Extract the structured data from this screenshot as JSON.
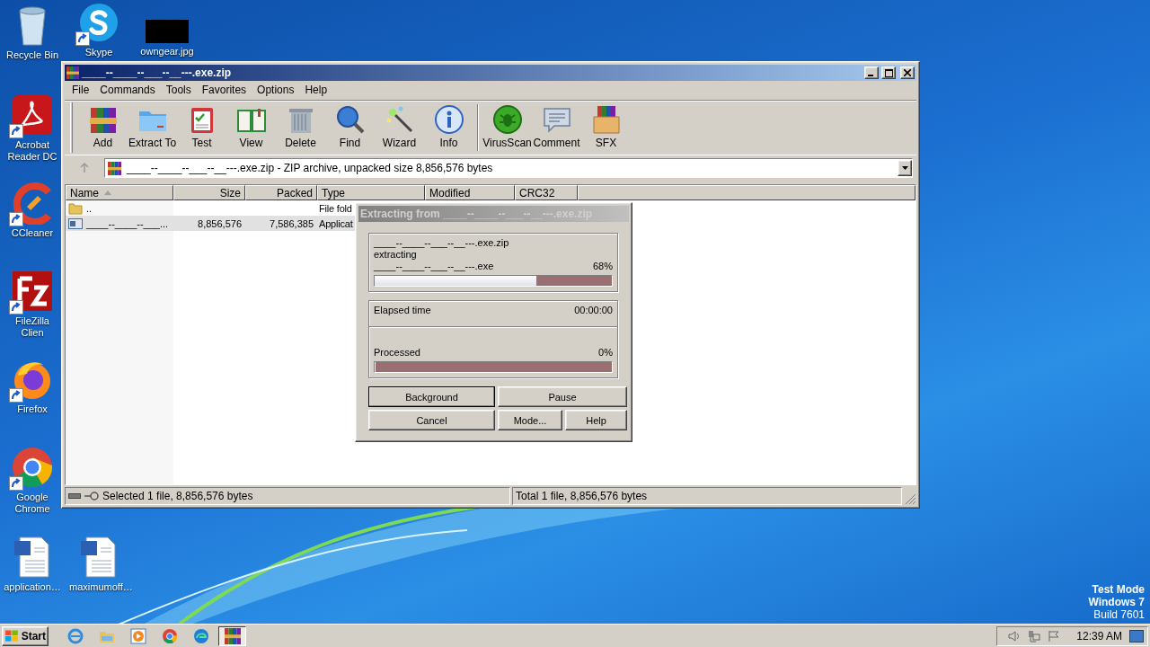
{
  "desktop_icons": [
    {
      "label": "Recycle Bin",
      "kind": "recycle",
      "shortcut": false
    },
    {
      "label": "Skype",
      "kind": "skype",
      "shortcut": true
    },
    {
      "label": "owngear.jpg",
      "kind": "redacted",
      "shortcut": false
    },
    {
      "label": "Acrobat Reader DC",
      "kind": "pdf",
      "shortcut": true
    },
    {
      "label": "CCleaner",
      "kind": "ccleaner",
      "shortcut": true
    },
    {
      "label": "FileZilla Clien",
      "kind": "filezilla",
      "shortcut": true
    },
    {
      "label": "Firefox",
      "kind": "firefox",
      "shortcut": true
    },
    {
      "label": "Google Chrome",
      "kind": "chrome",
      "shortcut": true
    },
    {
      "label": "application…",
      "kind": "word",
      "shortcut": false
    },
    {
      "label": "maximumoff…",
      "kind": "word",
      "shortcut": false
    }
  ],
  "window": {
    "title": "____--____--___--__---.exe.zip",
    "menu": [
      "File",
      "Commands",
      "Tools",
      "Favorites",
      "Options",
      "Help"
    ],
    "toolbar_groups": [
      {
        "buttons": [
          {
            "label": "Add",
            "kind": "add"
          },
          {
            "label": "Extract To",
            "kind": "extract"
          },
          {
            "label": "Test",
            "kind": "test"
          },
          {
            "label": "View",
            "kind": "view"
          },
          {
            "label": "Delete",
            "kind": "delete"
          },
          {
            "label": "Find",
            "kind": "find"
          },
          {
            "label": "Wizard",
            "kind": "wizard"
          },
          {
            "label": "Info",
            "kind": "info"
          }
        ]
      },
      {
        "buttons": [
          {
            "label": "VirusScan",
            "kind": "virus"
          },
          {
            "label": "Comment",
            "kind": "comment"
          },
          {
            "label": "SFX",
            "kind": "sfx"
          }
        ]
      }
    ],
    "address": "____--____--___--__---.exe.zip - ZIP archive, unpacked size 8,856,576 bytes",
    "columns": [
      "Name",
      "Size",
      "Packed",
      "Type",
      "Modified",
      "CRC32"
    ],
    "rows": [
      {
        "name": "..",
        "type": "File fold",
        "kind": "folder",
        "selected": false
      },
      {
        "name": "____--____--___...",
        "size": "8,856,576",
        "packed": "7,586,385",
        "type": "Applicat",
        "kind": "app",
        "selected": true
      }
    ],
    "status_left": "Selected 1 file, 8,856,576 bytes",
    "status_right": "Total 1 file, 8,856,576 bytes"
  },
  "dialog": {
    "title": "Extracting from ____--____--___--__---.exe.zip",
    "active": false,
    "archive": "____--____--___--__---.exe.zip",
    "action": "extracting",
    "file": "____--____--___--__---.exe",
    "file_progress": {
      "percent": "68%",
      "level": 0.68
    },
    "elapsed_label": "Elapsed time",
    "elapsed": "00:00:00",
    "processed_label": "Processed",
    "processed_progress": {
      "percent": "0%",
      "level": 0
    },
    "buttons": [
      {
        "label": "Background",
        "default": true
      },
      {
        "label": "Pause",
        "default": false
      },
      {
        "label": "Cancel",
        "default": false
      },
      {
        "label": "Mode...",
        "default": false
      },
      {
        "label": "Help",
        "default": false
      }
    ]
  },
  "taskbar": {
    "start": "Start",
    "items": [
      {
        "kind": "ie",
        "selected": false
      },
      {
        "kind": "explorer",
        "selected": false
      },
      {
        "kind": "media",
        "selected": false
      },
      {
        "kind": "chrome",
        "selected": false
      },
      {
        "kind": "edge",
        "selected": false
      },
      {
        "kind": "winrar",
        "selected": true
      }
    ],
    "clock": "12:39 AM"
  },
  "watermark_lines": [
    "Test Mode",
    "Windows 7",
    "Build 7601"
  ]
}
